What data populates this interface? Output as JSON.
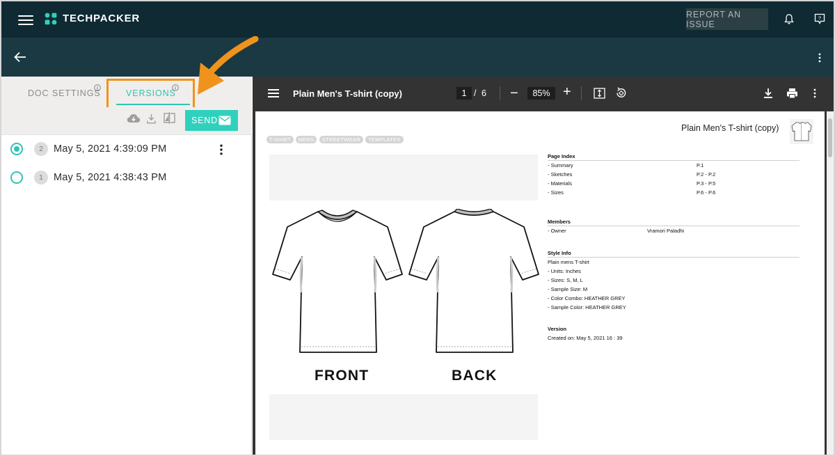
{
  "app": {
    "brand": "TECHPACKER",
    "report_issue_label": "REPORT AN ISSUE"
  },
  "tabs": {
    "doc_settings_label": "DOC SETTINGS",
    "versions_label": "VERSIONS"
  },
  "actions": {
    "send_label": "SEND"
  },
  "versions": [
    {
      "number": "2",
      "date": "May 5, 2021 4:39:09 PM",
      "selected": true
    },
    {
      "number": "1",
      "date": "May 5, 2021 4:38:43 PM",
      "selected": false
    }
  ],
  "viewer": {
    "title": "Plain Men's T-shirt (copy)",
    "current_page": "1",
    "page_separator": "/",
    "total_pages": "6",
    "zoom": "85%",
    "zoom_out_symbol": "−",
    "zoom_in_symbol": "+"
  },
  "document": {
    "title": "Plain Men's T-shirt (copy)",
    "tags": [
      "T-SHIRT",
      "MENS",
      "STREETWEAR",
      "TEMPLATES"
    ],
    "front_label": "FRONT",
    "back_label": "BACK",
    "page_index": {
      "title": "Page Index",
      "rows": [
        {
          "label": "- Summary",
          "value": "P.1"
        },
        {
          "label": "- Sketches",
          "value": "P.2 - P.2"
        },
        {
          "label": "- Materials",
          "value": "P.3 - P.5"
        },
        {
          "label": "- Sizes",
          "value": "P.6 - P.6"
        }
      ]
    },
    "members": {
      "title": "Members",
      "rows": [
        {
          "label": "- Owner",
          "value": "Vramori Paladhi"
        }
      ]
    },
    "style_info": {
      "title": "Style Info",
      "lines": [
        "Plain mens T-shirt",
        "- Units: Inches",
        "- Sizes: S, M, L",
        "- Sample Size: M",
        "- Color Combo: HEATHER GREY",
        "- Sample Color: HEATHER GREY"
      ]
    },
    "version": {
      "title": "Version",
      "created": "Created on: May 5, 2021 16 : 39"
    }
  },
  "colors": {
    "topbar": "#0f2a33",
    "subheader": "#1a3943",
    "accent": "#2fc4b2",
    "send_button": "#2fd1bd",
    "highlight": "#f0931c",
    "viewer_bg": "#333333"
  },
  "icons": [
    "menu-icon",
    "logo-icon",
    "bell-icon",
    "help-icon",
    "back-arrow-icon",
    "more-vertical-icon",
    "info-icon",
    "cloud-download-icon",
    "download-icon",
    "compare-icon",
    "mail-icon",
    "fit-page-icon",
    "rotate-icon",
    "print-icon"
  ]
}
